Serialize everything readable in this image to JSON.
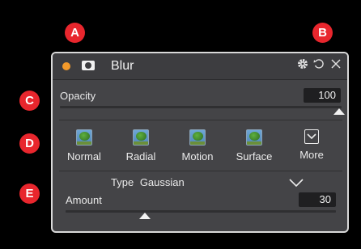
{
  "callouts": [
    "A",
    "B",
    "C",
    "D",
    "E"
  ],
  "panel": {
    "title": "Blur",
    "header_icons": [
      "orange-dot-icon",
      "mask-icon",
      "gear-icon",
      "reset-icon",
      "close-icon"
    ],
    "accent_color": "#f39a2b"
  },
  "opacity": {
    "label": "Opacity",
    "value": "100",
    "level": 1.0
  },
  "blur_types": [
    {
      "label": "Normal",
      "icon": "tree-thumbnail-icon"
    },
    {
      "label": "Radial",
      "icon": "tree-thumbnail-icon"
    },
    {
      "label": "Motion",
      "icon": "tree-thumbnail-icon"
    },
    {
      "label": "Surface",
      "icon": "tree-thumbnail-icon"
    },
    {
      "label": "More",
      "icon": "chevron-down-box-icon"
    }
  ],
  "type": {
    "label": "Type",
    "value": "Gaussian"
  },
  "amount": {
    "label": "Amount",
    "value": "30",
    "level": 0.3
  }
}
